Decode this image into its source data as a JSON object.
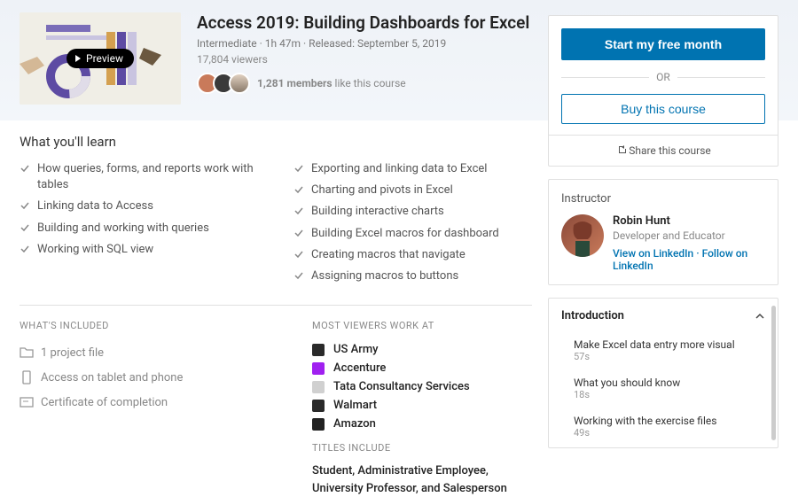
{
  "hero": {
    "title": "Access 2019: Building Dashboards for Excel",
    "level": "Intermediate",
    "duration": "1h 47m",
    "released": "Released: September 5, 2019",
    "viewers": "17,804 viewers",
    "likes_count": "1,281 members",
    "likes_suffix": "like this course",
    "preview_label": "Preview"
  },
  "cta": {
    "primary": "Start my free month",
    "or": "OR",
    "secondary": "Buy this course",
    "share": "Share this course"
  },
  "learn": {
    "heading": "What you'll learn",
    "col1": [
      "How queries, forms, and reports work with tables",
      "Linking data to Access",
      "Building and working with queries",
      "Working with SQL view"
    ],
    "col2": [
      "Exporting and linking data to Excel",
      "Charting and pivots in Excel",
      "Building interactive charts",
      "Building Excel macros for dashboard",
      "Creating macros that navigate",
      "Assigning macros to buttons"
    ]
  },
  "included": {
    "heading": "What's Included",
    "items": [
      "1 project file",
      "Access on tablet and phone",
      "Certificate of completion"
    ]
  },
  "viewers": {
    "heading": "Most Viewers Work At",
    "companies": [
      "US Army",
      "Accenture",
      "Tata Consultancy Services",
      "Walmart",
      "Amazon"
    ],
    "titles_heading": "Titles Include",
    "titles": "Student, Administrative Employee, University Professor, and Salesperson"
  },
  "instructor": {
    "heading": "Instructor",
    "name": "Robin Hunt",
    "role": "Developer and Educator",
    "link1": "View on LinkedIn",
    "link2": "Follow on LinkedIn"
  },
  "chapters": {
    "title": "Introduction",
    "lessons": [
      {
        "t": "Make Excel data entry more visual",
        "d": "57s"
      },
      {
        "t": "What you should know",
        "d": "18s"
      },
      {
        "t": "Working with the exercise files",
        "d": "49s"
      }
    ]
  }
}
